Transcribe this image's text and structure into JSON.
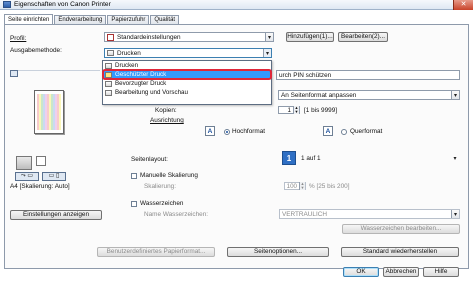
{
  "window": {
    "title": "Eigenschaften von Canon Printer",
    "close_glyph": "✕"
  },
  "tabs": [
    {
      "label": "Seite einrichten"
    },
    {
      "label": "Endverarbeitung"
    },
    {
      "label": "Papierzufuhr"
    },
    {
      "label": "Qualität"
    }
  ],
  "profile": {
    "label": "Profil:",
    "value": "Standardeinstellungen",
    "add_button": "Hinzufügen(1)...",
    "edit_button": "Bearbeiten(2)..."
  },
  "output_method": {
    "label": "Ausgabemethode:",
    "value": "Drucken",
    "options": [
      "Drucken",
      "Geschützter Druck",
      "Bevorzugter Druck",
      "Bearbeitung und Vorschau"
    ],
    "selected_index": 1
  },
  "right_panel": {
    "pin_text": "urch PIN schützen",
    "page_size_value": "An Seitenformat anpassen",
    "copies_label": "Kopien:",
    "copies_value": "1",
    "copies_range": "[1 bis 9999]",
    "orientation_label": "Ausrichtung",
    "portrait_label": "Hochformat",
    "landscape_label": "Querformat",
    "orientation_selected": "portrait",
    "layout_label": "Seitenlayout:",
    "layout_value": "1 auf 1",
    "layout_icon_text": "1",
    "manual_scaling_label": "Manuelle Skalierung",
    "scaling_label": "Skalierung:",
    "scaling_value": "100",
    "scaling_range": "% [25 bis 200]",
    "watermark_label": "Wasserzeichen",
    "watermark_name_label": "Name Wasserzeichen:",
    "watermark_value": "VERTRAULICH",
    "edit_watermark_button": "Wasserzeichen bearbeiten..."
  },
  "left_panel": {
    "preview_caption": "A4 [Skalierung: Auto]",
    "settings_button": "Einstellungen anzeigen"
  },
  "bottom_buttons": {
    "custom_paper": "Benutzerdefiniertes Papierformat...",
    "page_options": "Seitenoptionen...",
    "restore_defaults": "Standard wiederherstellen"
  },
  "dialog_buttons": {
    "ok": "OK",
    "cancel": "Abbrechen",
    "help": "Hilfe"
  },
  "colors": {
    "accent": "#3399ff",
    "highlight_border": "#e0273a",
    "title_gradient": "#dfe8f3"
  }
}
